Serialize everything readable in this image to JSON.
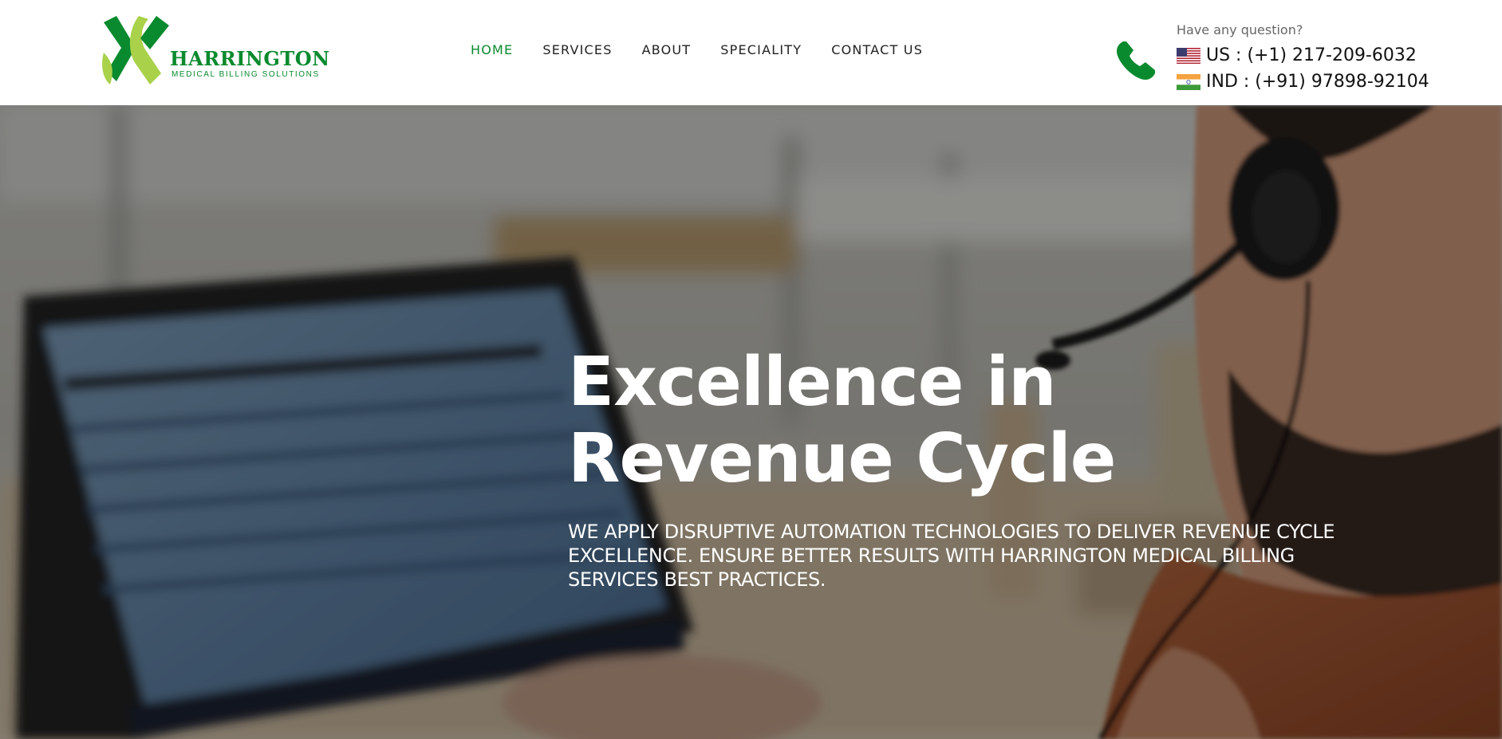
{
  "brand": {
    "name": "HARRINGTON",
    "tagline": "MEDICAL BILLING SOLUTIONS",
    "colors": {
      "primary_green": "#0a8a2e",
      "light_green": "#a9d14a"
    }
  },
  "nav": {
    "items": [
      {
        "label": "HOME",
        "active": true
      },
      {
        "label": "SERVICES",
        "active": false
      },
      {
        "label": "ABOUT",
        "active": false
      },
      {
        "label": "SPECIALITY",
        "active": false
      },
      {
        "label": "CONTACT US",
        "active": false
      }
    ]
  },
  "contact": {
    "icon": "phone-icon",
    "question": "Have any question?",
    "phones": [
      {
        "flag": "us-flag-icon",
        "text": "US : (+1) 217-209-6032"
      },
      {
        "flag": "india-flag-icon",
        "text": "IND : (+91) 97898-92104"
      }
    ]
  },
  "hero": {
    "title_line1": "Excellence in",
    "title_line2": "Revenue Cycle",
    "subtitle": "WE APPLY DISRUPTIVE AUTOMATION TECHNOLOGIES TO DELIVER REVENUE CYCLE EXCELLENCE. ENSURE BETTER RESULTS WITH HARRINGTON MEDICAL BILLING SERVICES BEST PRACTICES."
  }
}
